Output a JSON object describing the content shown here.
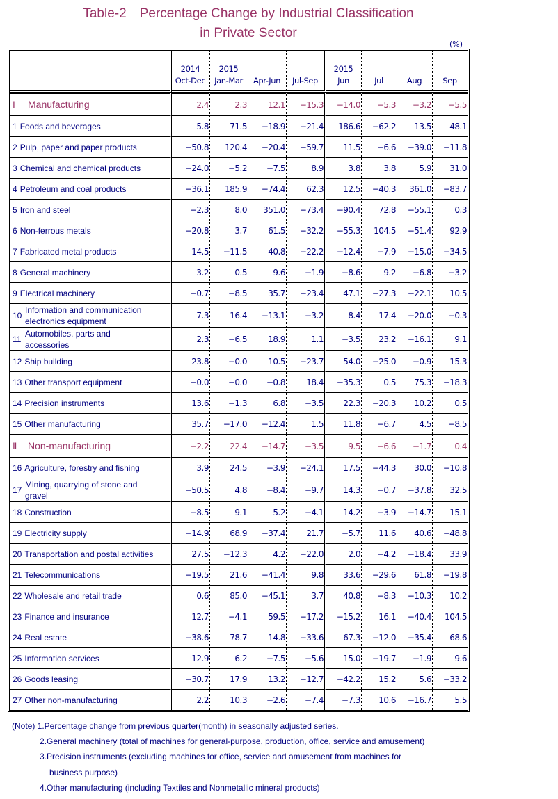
{
  "title": {
    "line1": "Table-2　Percentage Change by Industrial Classification",
    "line2": "in Private Sector"
  },
  "unit": "(%)",
  "colors": {
    "title": "#993366",
    "section": "#993366",
    "label": "#000080",
    "value": "#008000"
  },
  "header": {
    "quarters": [
      {
        "year": "2014",
        "period": "Oct-Dec"
      },
      {
        "year": "2015",
        "period": "Jan-Mar"
      },
      {
        "year": "",
        "period": "Apr-Jun"
      },
      {
        "year": "",
        "period": "Jul-Sep"
      }
    ],
    "months": [
      {
        "year": "2015",
        "period": "Jun"
      },
      {
        "year": "",
        "period": "Jul"
      },
      {
        "year": "",
        "period": "Aug"
      },
      {
        "year": "",
        "period": "Sep"
      }
    ]
  },
  "rows": [
    {
      "type": "section",
      "idx": "Ⅰ",
      "label": "Manufacturing",
      "values": [
        "2.4",
        "2.3",
        "12.1",
        "−15.3",
        "−14.0",
        "−5.3",
        "−3.2",
        "−5.5"
      ]
    },
    {
      "type": "item",
      "idx": "1",
      "label": "Foods and beverages",
      "values": [
        "5.8",
        "71.5",
        "−18.9",
        "−21.4",
        "186.6",
        "−62.2",
        "13.5",
        "48.1"
      ]
    },
    {
      "type": "item",
      "idx": "2",
      "label": "Pulp, paper and paper products",
      "values": [
        "−50.8",
        "120.4",
        "−20.4",
        "−59.7",
        "11.5",
        "−6.6",
        "−39.0",
        "−11.8"
      ]
    },
    {
      "type": "item",
      "idx": "3",
      "label": "Chemical and chemical products",
      "values": [
        "−24.0",
        "−5.2",
        "−7.5",
        "8.9",
        "3.8",
        "3.8",
        "5.9",
        "31.0"
      ]
    },
    {
      "type": "item",
      "idx": "4",
      "label": "Petroleum and coal products",
      "values": [
        "−36.1",
        "185.9",
        "−74.4",
        "62.3",
        "12.5",
        "−40.3",
        "361.0",
        "−83.7"
      ]
    },
    {
      "type": "item",
      "idx": "5",
      "label": "Iron and steel",
      "values": [
        "−2.3",
        "8.0",
        "351.0",
        "−73.4",
        "−90.4",
        "72.8",
        "−55.1",
        "0.3"
      ]
    },
    {
      "type": "item",
      "idx": "6",
      "label": "Non-ferrous metals",
      "values": [
        "−20.8",
        "3.7",
        "61.5",
        "−32.2",
        "−55.3",
        "104.5",
        "−51.4",
        "92.9"
      ]
    },
    {
      "type": "item",
      "idx": "7",
      "label": "Fabricated metal products",
      "values": [
        "14.5",
        "−11.5",
        "40.8",
        "−22.2",
        "−12.4",
        "−7.9",
        "−15.0",
        "−34.5"
      ]
    },
    {
      "type": "item",
      "idx": "8",
      "label": "General machinery",
      "values": [
        "3.2",
        "0.5",
        "9.6",
        "−1.9",
        "−8.6",
        "9.2",
        "−6.8",
        "−3.2"
      ]
    },
    {
      "type": "item",
      "idx": "9",
      "label": "Electrical machinery",
      "values": [
        "−0.7",
        "−8.5",
        "35.7",
        "−23.4",
        "47.1",
        "−27.3",
        "−22.1",
        "10.5"
      ]
    },
    {
      "type": "item2",
      "idx": "10",
      "label": "Information and communication",
      "label2": "electronics equipment",
      "values": [
        "7.3",
        "16.4",
        "−13.1",
        "−3.2",
        "8.4",
        "17.4",
        "−20.0",
        "−0.3"
      ]
    },
    {
      "type": "item2",
      "idx": "11",
      "label": "Automobiles, parts and",
      "label2": "accessories",
      "values": [
        "2.3",
        "−6.5",
        "18.9",
        "1.1",
        "−3.5",
        "23.2",
        "−16.1",
        "9.1"
      ]
    },
    {
      "type": "item",
      "idx": "12",
      "label": "Ship building",
      "values": [
        "23.8",
        "−0.0",
        "10.5",
        "−23.7",
        "54.0",
        "−25.0",
        "−0.9",
        "15.3"
      ]
    },
    {
      "type": "item",
      "idx": "13",
      "label": "Other transport equipment",
      "values": [
        "−0.0",
        "−0.0",
        "−0.8",
        "18.4",
        "−35.3",
        "0.5",
        "75.3",
        "−18.3"
      ]
    },
    {
      "type": "item",
      "idx": "14",
      "label": "Precision instruments",
      "values": [
        "13.6",
        "−1.3",
        "6.8",
        "−3.5",
        "22.3",
        "−20.3",
        "10.2",
        "0.5"
      ]
    },
    {
      "type": "item",
      "idx": "15",
      "label": "Other manufacturing",
      "values": [
        "35.7",
        "−17.0",
        "−12.4",
        "1.5",
        "11.8",
        "−6.7",
        "4.5",
        "−8.5"
      ]
    },
    {
      "type": "section",
      "idx": "Ⅱ",
      "label": "Non-manufacturing",
      "values": [
        "−2.2",
        "22.4",
        "−14.7",
        "−3.5",
        "9.5",
        "−6.6",
        "−1.7",
        "0.4"
      ]
    },
    {
      "type": "item",
      "idx": "16",
      "label": "Agriculture, forestry and fishing",
      "values": [
        "3.9",
        "24.5",
        "−3.9",
        "−24.1",
        "17.5",
        "−44.3",
        "30.0",
        "−10.8"
      ]
    },
    {
      "type": "item2",
      "idx": "17",
      "label": "Mining, quarrying of stone and",
      "label2": "gravel",
      "values": [
        "−50.5",
        "4.8",
        "−8.4",
        "−9.7",
        "14.3",
        "−0.7",
        "−37.8",
        "32.5"
      ]
    },
    {
      "type": "item",
      "idx": "18",
      "label": "Construction",
      "values": [
        "−8.5",
        "9.1",
        "5.2",
        "−4.1",
        "14.2",
        "−3.9",
        "−14.7",
        "15.1"
      ]
    },
    {
      "type": "item",
      "idx": "19",
      "label": "Electricity supply",
      "values": [
        "−14.9",
        "68.9",
        "−37.4",
        "21.7",
        "−5.7",
        "11.6",
        "40.6",
        "−48.8"
      ]
    },
    {
      "type": "item",
      "idx": "20",
      "label": "Transportation and postal activities",
      "values": [
        "27.5",
        "−12.3",
        "4.2",
        "−22.0",
        "2.0",
        "−4.2",
        "−18.4",
        "33.9"
      ]
    },
    {
      "type": "item",
      "idx": "21",
      "label": "Telecommunications",
      "values": [
        "−19.5",
        "21.6",
        "−41.4",
        "9.8",
        "33.6",
        "−29.6",
        "61.8",
        "−19.8"
      ]
    },
    {
      "type": "item",
      "idx": "22",
      "label": "Wholesale and retail trade",
      "values": [
        "0.6",
        "85.0",
        "−45.1",
        "3.7",
        "40.8",
        "−8.3",
        "−10.3",
        "10.2"
      ]
    },
    {
      "type": "item",
      "idx": "23",
      "label": "Finance and insurance",
      "values": [
        "12.7",
        "−4.1",
        "59.5",
        "−17.2",
        "−15.2",
        "16.1",
        "−40.4",
        "104.5"
      ]
    },
    {
      "type": "item",
      "idx": "24",
      "label": "Real estate",
      "values": [
        "−38.6",
        "78.7",
        "14.8",
        "−33.6",
        "67.3",
        "−12.0",
        "−35.4",
        "68.6"
      ]
    },
    {
      "type": "item",
      "idx": "25",
      "label": "Information services",
      "values": [
        "12.9",
        "6.2",
        "−7.5",
        "−5.6",
        "15.0",
        "−19.7",
        "−1.9",
        "9.6"
      ]
    },
    {
      "type": "item",
      "idx": "26",
      "label": "Goods leasing",
      "values": [
        "−30.7",
        "17.9",
        "13.2",
        "−12.7",
        "−42.2",
        "15.2",
        "5.6",
        "−33.2"
      ]
    },
    {
      "type": "item",
      "idx": "27",
      "label": "Other non-manufacturing",
      "values": [
        "2.2",
        "10.3",
        "−2.6",
        "−7.4",
        "−7.3",
        "10.6",
        "−16.7",
        "5.5"
      ]
    }
  ],
  "notes": [
    "(Note) 1.Percentage change from previous quarter(month) in seasonally adjusted series.",
    "2.General machinery (total of machines for general-purpose, production, office, service and amusement)",
    "3.Precision instruments (excluding machines for office, service and amusement from machines for",
    "business purpose)",
    "4.Other manufacturing (including Textiles and Nonmetallic mineral products)"
  ]
}
